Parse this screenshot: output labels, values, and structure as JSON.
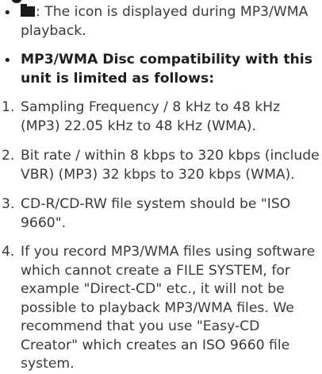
{
  "icon_bullet": {
    "icon": "folder-icon",
    "text": ": The icon is displayed during MP3/WMA playback."
  },
  "compat_heading": "MP3/WMA Disc compatibility with this unit is limited as follows:",
  "items": [
    {
      "number": "1.",
      "text": "Sampling Frequency / 8 kHz to 48 kHz (MP3) 22.05 kHz to 48 kHz (WMA)."
    },
    {
      "number": "2.",
      "text": "Bit rate / within 8 kbps to 320 kbps (include VBR) (MP3) 32 kbps to 320 kbps (WMA)."
    },
    {
      "number": "3.",
      "text": "CD-R/CD-RW file system should be \"ISO 9660\"."
    },
    {
      "number": "4.",
      "text": "If you record MP3/WMA files using software which cannot create a FILE SYSTEM, for example \"Direct-CD\" etc., it will not be possible to playback MP3/WMA files. We recommend that you use \"Easy-CD Creator\" which creates an ISO 9660 file system."
    }
  ]
}
